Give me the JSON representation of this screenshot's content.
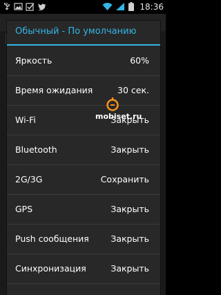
{
  "status_bar": {
    "time": "18:36",
    "left_icons": [
      "usb-icon",
      "image-icon",
      "checkbox-icon",
      "twitter-icon"
    ],
    "right_icons": [
      "wifi-icon",
      "signal-icon",
      "battery-icon"
    ]
  },
  "dialog": {
    "title": "Обычный - По умолчанию",
    "accent_color": "#33b5e5",
    "rows": [
      {
        "label": "Яркость",
        "value": "60%"
      },
      {
        "label": "Время ожидания",
        "value": "30 сек."
      },
      {
        "label": "Wi-Fi",
        "value": "Закрыть"
      },
      {
        "label": "Bluetooth",
        "value": "Закрыть"
      },
      {
        "label": "2G/3G",
        "value": "Сохранить"
      },
      {
        "label": "GPS",
        "value": "Закрыть"
      },
      {
        "label": "Push сообщения",
        "value": "Закрыть"
      },
      {
        "label": "Синхронизация",
        "value": "Закрыть"
      }
    ]
  },
  "watermark": {
    "text": "mobiset.ru",
    "color": "#f7941d"
  }
}
